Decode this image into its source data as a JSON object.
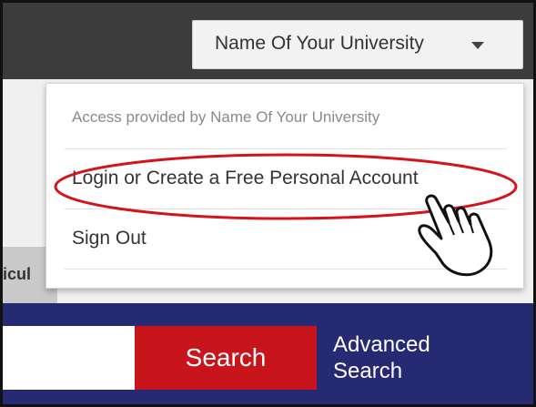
{
  "header": {
    "university_button": {
      "label": "Name Of Your University",
      "icon": "chevron-down-icon"
    }
  },
  "dropdown": {
    "access_text": "Access provided by Name Of Your University",
    "items": [
      {
        "label": "Login or Create a Free Personal Account"
      },
      {
        "label": "Sign Out"
      }
    ]
  },
  "background": {
    "partial_text": "icul"
  },
  "search_bar": {
    "input_value": "",
    "search_button": "Search",
    "advanced_line1": "Advanced",
    "advanced_line2": "Search"
  },
  "colors": {
    "topbar": "#3c3c3c",
    "navy": "#262a73",
    "search_button": "#c8141b",
    "highlight": "#d3141b"
  },
  "annotations": {
    "highlight": "red-ellipse-around-login-link",
    "pointer": "hand-pointer-icon"
  }
}
